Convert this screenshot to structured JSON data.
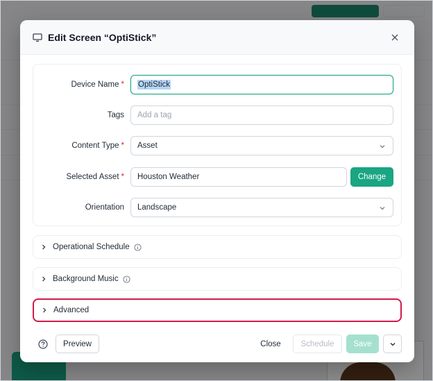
{
  "modal": {
    "title": "Edit Screen “OptiStick”",
    "icon": "monitor-icon",
    "close_icon": "close-icon"
  },
  "form": {
    "device_name": {
      "label": "Device Name",
      "value": "OptiStick",
      "required": true
    },
    "tags": {
      "label": "Tags",
      "placeholder": "Add a tag"
    },
    "content_type": {
      "label": "Content Type",
      "value": "Asset",
      "required": true
    },
    "selected_asset": {
      "label": "Selected Asset",
      "value": "Houston Weather",
      "required": true,
      "change_label": "Change"
    },
    "orientation": {
      "label": "Orientation",
      "value": "Landscape"
    },
    "required_marker": "*"
  },
  "sections": [
    {
      "label": "Operational Schedule",
      "has_info": true
    },
    {
      "label": "Background Music",
      "has_info": true
    },
    {
      "label": "Advanced",
      "has_info": false,
      "highlighted": true
    }
  ],
  "footer": {
    "preview_label": "Preview",
    "close_label": "Close",
    "schedule_label": "Schedule",
    "save_label": "Save"
  },
  "colors": {
    "accent": "#1aa583",
    "highlight": "#d11a4a",
    "required": "#dc2626"
  }
}
